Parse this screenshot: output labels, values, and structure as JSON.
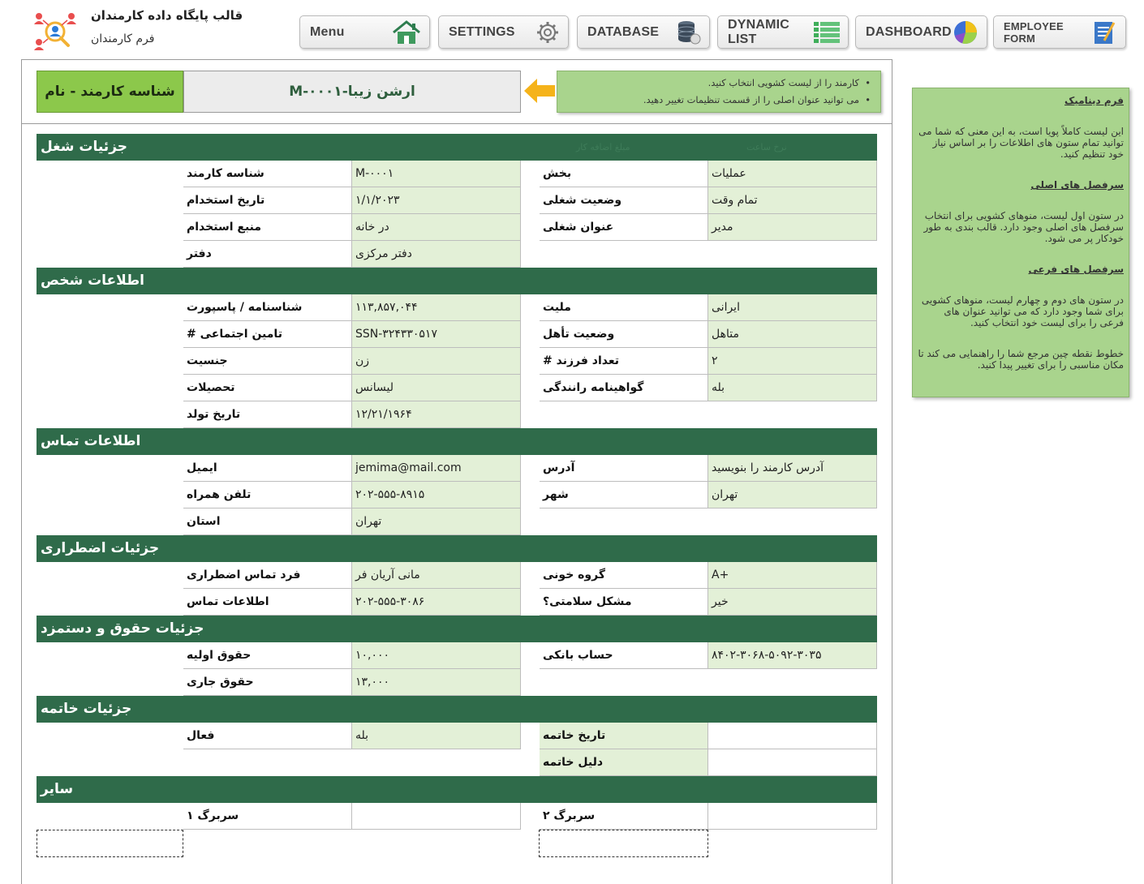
{
  "header": {
    "title": "قالب پایگاه داده کارمندان",
    "subtitle": "فرم کارمندان"
  },
  "nav": {
    "menu": "Menu",
    "settings": "SETTINGS",
    "database": "DATABASE",
    "dynamic_list": "DYNAMIC LIST",
    "dashboard": "DASHBOARD",
    "employee_form": "EMPLOYEE FORM"
  },
  "selector": {
    "label": "شناسه کارمند - نام",
    "value": "ارشن زیبا-M-۰۰۰۱",
    "hints": [
      "کارمند را از لیست کشویی انتخاب کنید.",
      "می توانید عنوان اصلی را از قسمت تنظیمات تغییر دهید."
    ]
  },
  "sections": {
    "job": {
      "title": "جزئیات شغل",
      "ghost_1": "مبلغ اضافه کار",
      "ghost_2": "نرخ ساعت",
      "employee_id_label": "شناسه کارمند",
      "employee_id": "M-۰۰۰۱",
      "hire_date_label": "تاریخ استخدام",
      "hire_date": "۱/۱/۲۰۲۳",
      "source_label": "منبع استخدام",
      "source": "در خانه",
      "office_label": "دفتر",
      "office": "دفتر مرکزی",
      "department_label": "بخش",
      "department": "عملیات",
      "status_label": "وضعیت شغلی",
      "status": "تمام وقت",
      "job_title_label": "عنوان شغلی",
      "job_title": "مدیر"
    },
    "personal": {
      "title": "اطلاعات شخص",
      "passport_label": "شناسنامه / پاسپورت",
      "passport": "۱۱۳,۸۵۷,۰۴۴",
      "ssn_label": "تامین اجتماعی #",
      "ssn": "SSN-۳۲۴۳۳۰۵۱۷",
      "gender_label": "جنسیت",
      "gender": "زن",
      "education_label": "تحصیلات",
      "education": "لیسانس",
      "birth_label": "تاریخ تولد",
      "birth": "۱۲/۲۱/۱۹۶۴",
      "nationality_label": "ملیت",
      "nationality": "ایرانی",
      "marital_label": "وضعیت تأهل",
      "marital": "متاهل",
      "children_label": "تعداد فرزند #",
      "children": "۲",
      "license_label": "گواهینامه رانندگی",
      "license": "بله"
    },
    "contact": {
      "title": "اطلاعات تماس",
      "email_label": "ایمیل",
      "email": "jemima@mail.com",
      "mobile_label": "تلفن همراه",
      "mobile": "۲۰۲-۵۵۵-۸۹۱۵",
      "province_label": "استان",
      "province": "تهران",
      "address_label": "آدرس",
      "address": "آدرس کارمند را بنویسید",
      "city_label": "شهر",
      "city": "تهران"
    },
    "emergency": {
      "title": "جزئیات اضطراری",
      "person_label": "فرد تماس اضطراری",
      "person": "مانی آریان فر",
      "phone_label": "اطلاعات تماس",
      "phone": "۲۰۲-۵۵۵-۳۰۸۶",
      "blood_label": "گروه خونی",
      "blood": "A+",
      "health_label": "مشکل سلامتی؟",
      "health": "خیر"
    },
    "salary": {
      "title": "جزئیات حقوق و دستمزد",
      "initial_label": "حقوق اولیه",
      "initial": "۱۰,۰۰۰",
      "current_label": "حقوق جاری",
      "current": "۱۳,۰۰۰",
      "bank_label": "حساب بانکی",
      "bank": "۸۴۰۲-۳۰۶۸-۵۰۹۲-۳۰۳۵"
    },
    "termination": {
      "title": "جزئیات خاتمه",
      "active_label": "فعال",
      "active": "بله",
      "date_label": "تاریخ خاتمه",
      "date": "",
      "reason_label": "دلیل خاتمه",
      "reason": ""
    },
    "other": {
      "title": "سایر",
      "header1_label": "سربرگ ۱",
      "header1": "",
      "header2_label": "سربرگ ۲",
      "header2": ""
    }
  },
  "side_note": {
    "h1": "فرم دینامیک",
    "p1": "این لیست کاملاً پویا است، به این معنی که شما می توانید تمام ستون های اطلاعات را بر اساس نیاز خود تنظیم کنید.",
    "h2": "سرفصل های اصلی",
    "p2": "در ستون اول لیست، منوهای کشویی برای انتخاب سرفصل های اصلی وجود دارد. قالب بندی به طور خودکار پر می شود.",
    "h3": "سرفصل های فرعی",
    "p3": "در ستون های دوم و چهارم لیست، منوهای کشویی برای شما وجود دارد که می توانید عنوان های فرعی را برای لیست خود انتخاب کنید.",
    "p4": "خطوط نقطه چین مرجع شما را راهنمایی می کند تا مکان مناسبی را برای تغییر پیدا کنید."
  },
  "colors": {
    "section_bar": "#2f6b4a",
    "value_fill": "#e3f0d7",
    "label_green": "#8cc84b",
    "note_green": "#a9d48d",
    "arrow": "#f5b31a"
  },
  "icons": {
    "logo": "people-network-icon",
    "menu": "home-icon",
    "settings": "gear-icon",
    "database": "database-icon",
    "dynamic_list": "list-icon",
    "dashboard": "pie-chart-icon",
    "employee_form": "form-icon",
    "arrow": "arrow-left-icon"
  }
}
